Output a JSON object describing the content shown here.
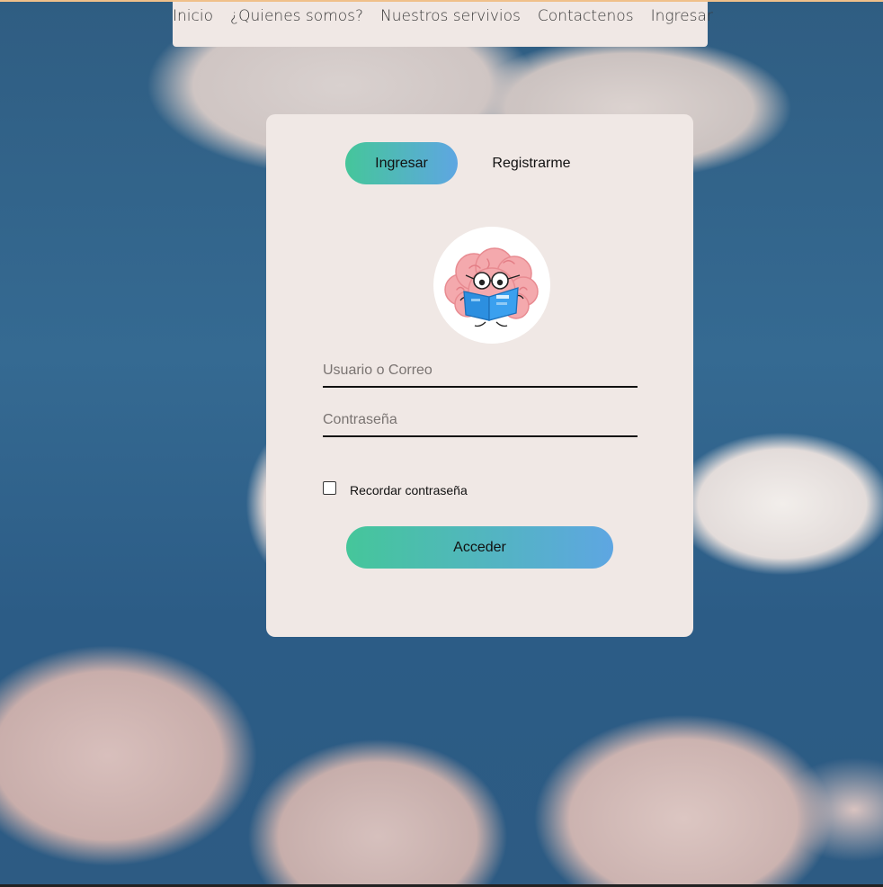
{
  "nav": {
    "items": [
      {
        "label": "Inicio"
      },
      {
        "label": "¿Quienes somos?"
      },
      {
        "label": "Nuestros servivios"
      },
      {
        "label": "Contactenos"
      },
      {
        "label": "Ingresar"
      }
    ]
  },
  "login": {
    "tabs": {
      "login_label": "Ingresar",
      "register_label": "Registrarme"
    },
    "avatar_icon": "brain-reading-book-icon",
    "username_placeholder": "Usuario o Correo",
    "username_value": "",
    "password_placeholder": "Contraseña",
    "password_value": "",
    "remember_label": "Recordar contraseña",
    "remember_checked": false,
    "submit_label": "Acceder"
  },
  "colors": {
    "card_bg": "#f0e8e5",
    "gradient_start": "#45c69a",
    "gradient_end": "#5ea6e2"
  }
}
